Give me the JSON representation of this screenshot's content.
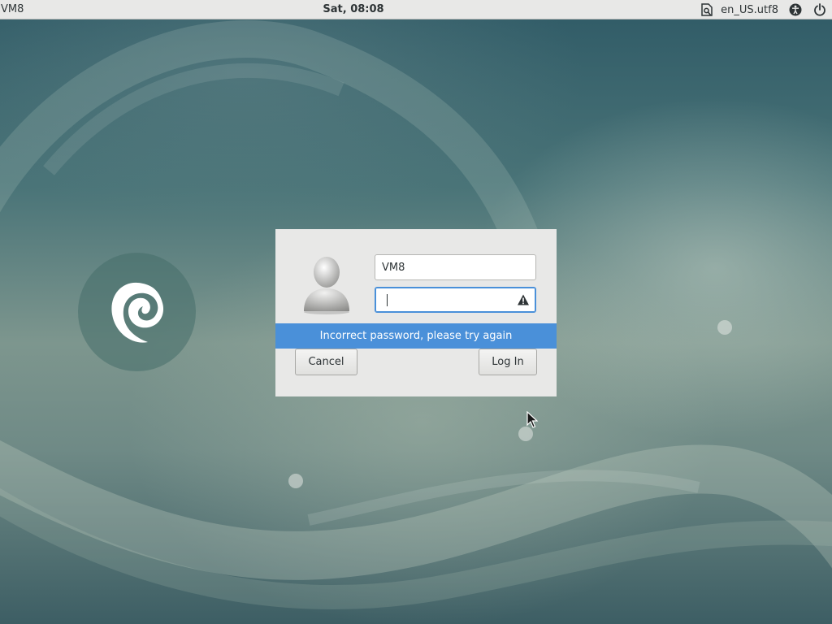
{
  "topbar": {
    "host_name": "VM8",
    "clock": "Sat, 08:08",
    "keyboard_icon": "keyboard-layout-icon",
    "locale": "en_US.utf8",
    "accessibility_icon": "accessibility-icon",
    "power_icon": "power-icon"
  },
  "desktop": {
    "logo": "debian-swirl-logo"
  },
  "login": {
    "avatar_icon": "user-avatar-icon",
    "username_value": "VM8",
    "password_value": "",
    "warning_icon": "warning-triangle-icon",
    "error_message": "Incorrect password, please try again",
    "cancel_label": "Cancel",
    "login_label": "Log In"
  },
  "colors": {
    "accent": "#4a90d9",
    "topbar_bg": "#e8e8e7",
    "dialog_bg": "#e8e8e7",
    "error_bar_bg": "#4a90d9"
  }
}
